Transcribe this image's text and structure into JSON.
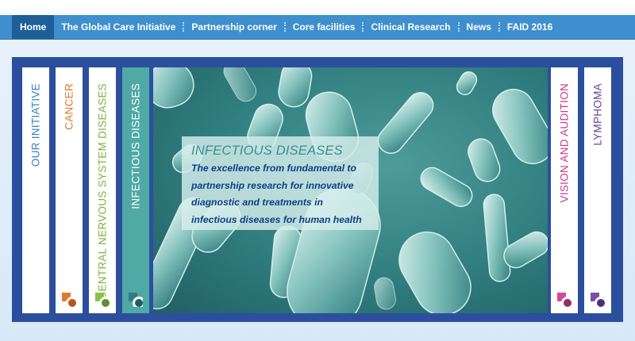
{
  "nav": {
    "items": [
      {
        "label": "Home",
        "active": true
      },
      {
        "label": "The Global Care Initiative"
      },
      {
        "label": "Partnership corner"
      },
      {
        "label": "Core facilities"
      },
      {
        "label": "Clinical Research"
      },
      {
        "label": "News"
      },
      {
        "label": "FAID 2016"
      }
    ]
  },
  "panels": {
    "our_initiative": {
      "label": "OUR INITIATIVE",
      "color": "#3a7fc4"
    },
    "cancer": {
      "label": "CANCER",
      "color": "#e07a2e"
    },
    "cns": {
      "label": "CENTRAL NERVOUS SYSTEM DISEASES",
      "color": "#7fb23f"
    },
    "infectious": {
      "label": "INFECTIOUS DISEASES",
      "color": "#ffffff",
      "bg": "#4fa9a4"
    },
    "vision": {
      "label": "VISION AND AUDITION",
      "color": "#c83a8a"
    },
    "lymphoma": {
      "label": "LYMPHOMA",
      "color": "#6a3f96"
    }
  },
  "hero": {
    "title": "INFECTIOUS DISEASES",
    "text": "The excellence from fundamental to partnership research for innovative diagnostic and treatments in infectious diseases for human health"
  }
}
